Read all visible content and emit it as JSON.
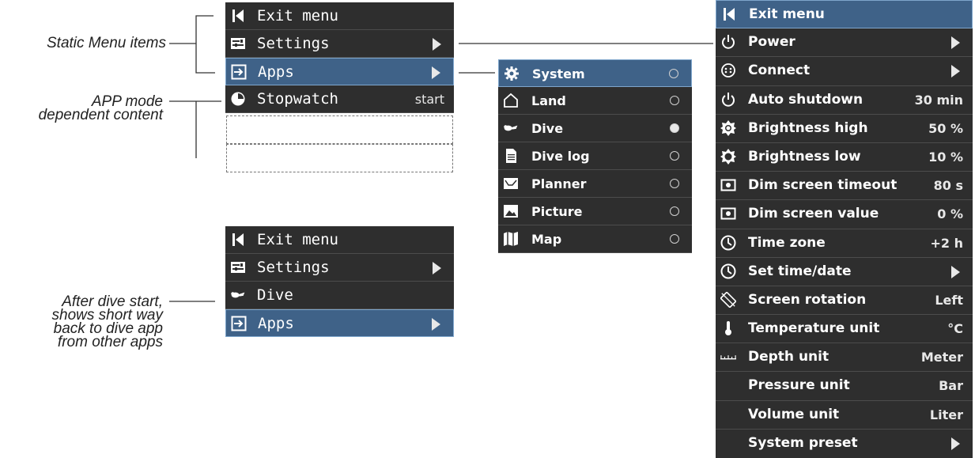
{
  "annotations": {
    "static": "Static Menu items",
    "app_mode_1": "APP mode",
    "app_mode_2": "dependent content",
    "after_1": "After dive start,",
    "after_2": "shows short way",
    "after_3": "back to dive app",
    "after_4": "from other apps"
  },
  "menu1": {
    "items": [
      {
        "label": "Exit menu"
      },
      {
        "label": "Settings"
      },
      {
        "label": "Apps"
      },
      {
        "label": "Stopwatch",
        "value": "start"
      }
    ]
  },
  "menu2": {
    "items": [
      {
        "label": "Exit menu"
      },
      {
        "label": "Settings"
      },
      {
        "label": "Dive"
      },
      {
        "label": "Apps"
      }
    ]
  },
  "apps_menu": {
    "items": [
      {
        "label": "System",
        "selected_app": false
      },
      {
        "label": "Land",
        "selected_app": false
      },
      {
        "label": "Dive",
        "selected_app": true
      },
      {
        "label": "Dive log",
        "selected_app": false
      },
      {
        "label": "Planner",
        "selected_app": false
      },
      {
        "label": "Picture",
        "selected_app": false
      },
      {
        "label": "Map",
        "selected_app": false
      }
    ]
  },
  "settings_menu": {
    "items": [
      {
        "label": "Exit menu",
        "value": ""
      },
      {
        "label": "Power",
        "value": ""
      },
      {
        "label": "Connect",
        "value": ""
      },
      {
        "label": "Auto shutdown",
        "value": "30 min"
      },
      {
        "label": "Brightness high",
        "value": "50 %"
      },
      {
        "label": "Brightness low",
        "value": "10 %"
      },
      {
        "label": "Dim screen timeout",
        "value": "80 s"
      },
      {
        "label": "Dim screen value",
        "value": "0 %"
      },
      {
        "label": "Time zone",
        "value": "+2 h"
      },
      {
        "label": "Set time/date",
        "value": ""
      },
      {
        "label": "Screen rotation",
        "value": "Left"
      },
      {
        "label": "Temperature unit",
        "value": "°C"
      },
      {
        "label": "Depth unit",
        "value": "Meter"
      },
      {
        "label": "Pressure unit",
        "value": "Bar"
      },
      {
        "label": "Volume unit",
        "value": "Liter"
      },
      {
        "label": "System preset",
        "value": ""
      }
    ]
  },
  "colors": {
    "menu_bg": "#2e2e2e",
    "selected_bg": "#3f6288",
    "text": "#ffffff"
  }
}
